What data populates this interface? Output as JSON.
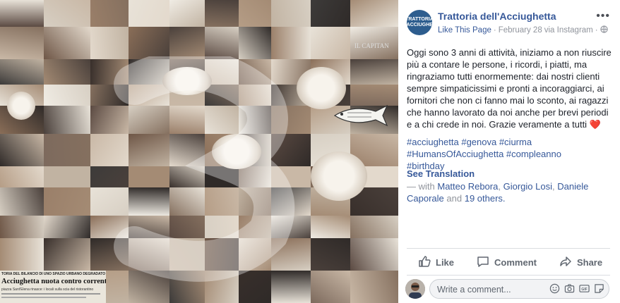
{
  "post": {
    "page_avatar_text": "TRATTORIA\ndell'ACCIUGHETTA",
    "page_name": "Trattoria dell'Acciughetta",
    "like_page": "Like This Page",
    "separator": "·",
    "date": "February 28",
    "via": "via Instagram",
    "text": "Oggi sono 3 anni di attività, iniziamo a non riuscire più a contare le persone, i ricordi, i piatti, ma ringraziamo tutti enormemente: dai nostri clienti sempre simpaticissimi e pronti a incoraggiarci, ai fornitori che non ci fanno mai lo sconto, ai ragazzi che hanno lavorato da noi anche per brevi periodi e a chi crede in noi. Grazie veramente a tutti",
    "heart": "❤️",
    "hashtags": [
      "#acciughetta #genova #ciurma",
      "#HumansOfAcciughetta #compleanno",
      "#birthday"
    ],
    "see_translation": "See Translation",
    "with_prefix": "— with",
    "tagged": [
      "Matteo Rebora",
      "Giorgio Losi",
      "Daniele Caporale"
    ],
    "sep1": ",",
    "sep2": ",",
    "and": "and",
    "others": "19 others.",
    "period": ""
  },
  "actions": {
    "like": "Like",
    "comment": "Comment",
    "share": "Share"
  },
  "comment_box": {
    "placeholder": "Write a comment..."
  },
  "photo": {
    "sign_text": "IL CAPITAN",
    "newspaper_header": "TORIA DEL BILANCIO DI UNO SPAZIO URBANO DEGRADATO",
    "newspaper_title": "Acciughetta nuota contro corrente",
    "newspaper_sub": "piazza Sant'Elena rinasce: i locali sulla scia del ristorantino"
  },
  "colors": {
    "link": "#365899",
    "muted": "#90949c",
    "text": "#1d2129",
    "heart": "#e0245e"
  }
}
